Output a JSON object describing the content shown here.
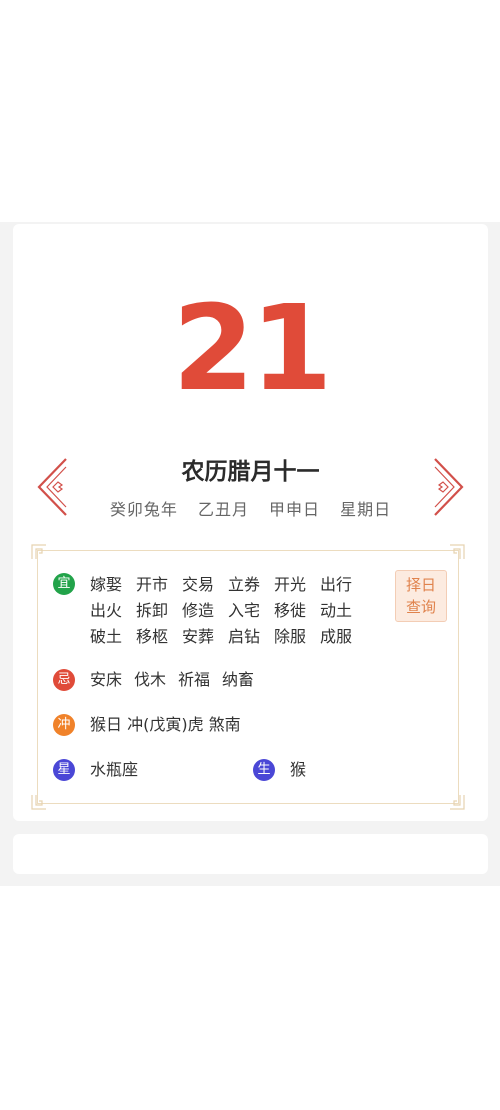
{
  "calendar": {
    "day": "21",
    "lunar_date": "农历腊月十一",
    "year_ganzhi": "癸卯兔年",
    "month_ganzhi": "乙丑月",
    "day_ganzhi": "甲申日",
    "weekday": "星期日"
  },
  "colors": {
    "accent": "#e04b39",
    "yi": "#22a34a",
    "ji": "#e04b39",
    "chong": "#f0822a",
    "star": "#4a47d6",
    "frame": "#ecdcbf"
  },
  "almanac": {
    "yi_label": "宜",
    "yi_items": [
      "嫁娶",
      "开市",
      "交易",
      "立券",
      "开光",
      "出行",
      "出火",
      "拆卸",
      "修造",
      "入宅",
      "移徙",
      "动土",
      "破土",
      "移柩",
      "安葬",
      "启钻",
      "除服",
      "成服"
    ],
    "ji_label": "忌",
    "ji_items": [
      "安床",
      "伐木",
      "祈福",
      "纳畜"
    ],
    "chong_label": "冲",
    "chong_text": "猴日 冲(戊寅)虎  煞南",
    "xing_label": "星",
    "constellation": "水瓶座",
    "sheng_label": "生",
    "zodiac": "猴",
    "zeri_line1": "择日",
    "zeri_line2": "查询"
  },
  "icons": {
    "prev": "chevron-left-icon",
    "next": "chevron-right-icon"
  }
}
